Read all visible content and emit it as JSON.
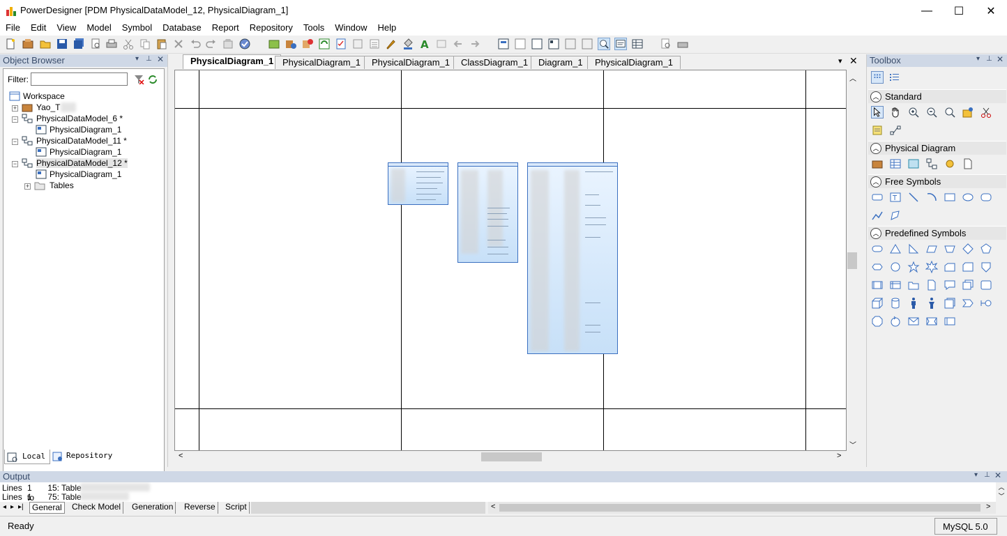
{
  "window": {
    "title": "PowerDesigner [PDM PhysicalDataModel_12, PhysicalDiagram_1]",
    "minimize": "—",
    "maximize": "☐",
    "close": "✕"
  },
  "menu": [
    "File",
    "Edit",
    "View",
    "Model",
    "Symbol",
    "Database",
    "Report",
    "Repository",
    "Tools",
    "Window",
    "Help"
  ],
  "object_browser": {
    "title": "Object Browser",
    "filter_label": "Filter:",
    "filter_value": "",
    "tree": [
      {
        "label": "Workspace",
        "level": 0
      },
      {
        "label": "Yao_T",
        "level": 1
      },
      {
        "label": "PhysicalDataModel_6 *",
        "level": 1
      },
      {
        "label": "PhysicalDiagram_1",
        "level": 2
      },
      {
        "label": "PhysicalDataModel_11 *",
        "level": 1
      },
      {
        "label": "PhysicalDiagram_1",
        "level": 2
      },
      {
        "label": "PhysicalDataModel_12 *",
        "level": 1
      },
      {
        "label": "PhysicalDiagram_1",
        "level": 2
      },
      {
        "label": "Tables",
        "level": 2
      }
    ],
    "bottom_tabs": [
      "Local",
      "Repository"
    ]
  },
  "diagram_tabs": [
    "PhysicalDiagram_1",
    "PhysicalDiagram_1",
    "PhysicalDiagram_1",
    "ClassDiagram_1",
    "Diagram_1",
    "PhysicalDiagram_1"
  ],
  "toolbox": {
    "title": "Toolbox",
    "sections": [
      "Standard",
      "Physical Diagram",
      "Free Symbols",
      "Predefined Symbols"
    ]
  },
  "output": {
    "title": "Output",
    "lines": [
      {
        "a": "Lines",
        "b": "1 to",
        "c": "15:",
        "d": "Table"
      },
      {
        "a": "Lines",
        "b": "1 to",
        "c": "75:",
        "d": "Table"
      }
    ],
    "tabs": [
      "General",
      "Check Model",
      "Generation",
      "Reverse",
      "Script"
    ]
  },
  "status": {
    "text": "Ready",
    "dbms": "MySQL 5.0"
  },
  "colors": {
    "pane_header": "#cfd8e6",
    "table_border": "#3a6fc0",
    "table_fill": "#c7e0f8"
  }
}
